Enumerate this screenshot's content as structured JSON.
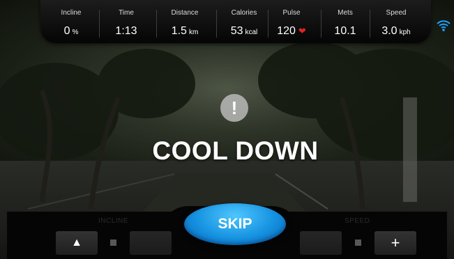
{
  "stats": [
    {
      "label": "Incline",
      "value": "0",
      "unit": "%"
    },
    {
      "label": "Time",
      "value": "1:13",
      "unit": ""
    },
    {
      "label": "Distance",
      "value": "1.5",
      "unit": "km"
    },
    {
      "label": "Calories",
      "value": "53",
      "unit": "kcal"
    },
    {
      "label": "Pulse",
      "value": "120",
      "unit": ""
    },
    {
      "label": "Mets",
      "value": "10.1",
      "unit": ""
    },
    {
      "label": "Speed",
      "value": "3.0",
      "unit": "kph"
    }
  ],
  "icons": {
    "pulse": "heart-icon",
    "connection": "wifi-icon",
    "alert": "exclamation-icon",
    "incline_up": "triangle-up-icon",
    "speed_up": "plus-icon"
  },
  "message": {
    "alert_glyph": "!",
    "title": "COOL DOWN"
  },
  "controls": {
    "incline_label": "INCLINE",
    "speed_label": "SPEED",
    "incline_up_glyph": "▲",
    "speed_up_glyph": "+",
    "skip_label": "SKIP"
  },
  "colors": {
    "skip_button": "#1592e0",
    "heart": "#e02226",
    "wifi": "#1aa3ff"
  }
}
